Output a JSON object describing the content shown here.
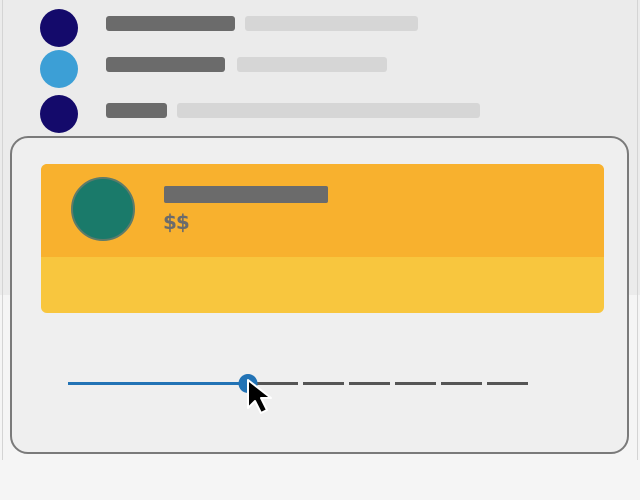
{
  "list": {
    "items": [
      {
        "avatar_color": "#140a6b"
      },
      {
        "avatar_color": "#3c9fd6"
      },
      {
        "avatar_color": "#140a6b"
      }
    ]
  },
  "card": {
    "promo": {
      "avatar_color": "#1a7a6a",
      "price_label": "$$",
      "background_top": "#f8b12e",
      "background_bottom": "#f8c63e"
    },
    "slider": {
      "value_fraction": 0.36,
      "steps": 8,
      "fill_color": "#2273b5",
      "track_color": "#555555"
    }
  }
}
